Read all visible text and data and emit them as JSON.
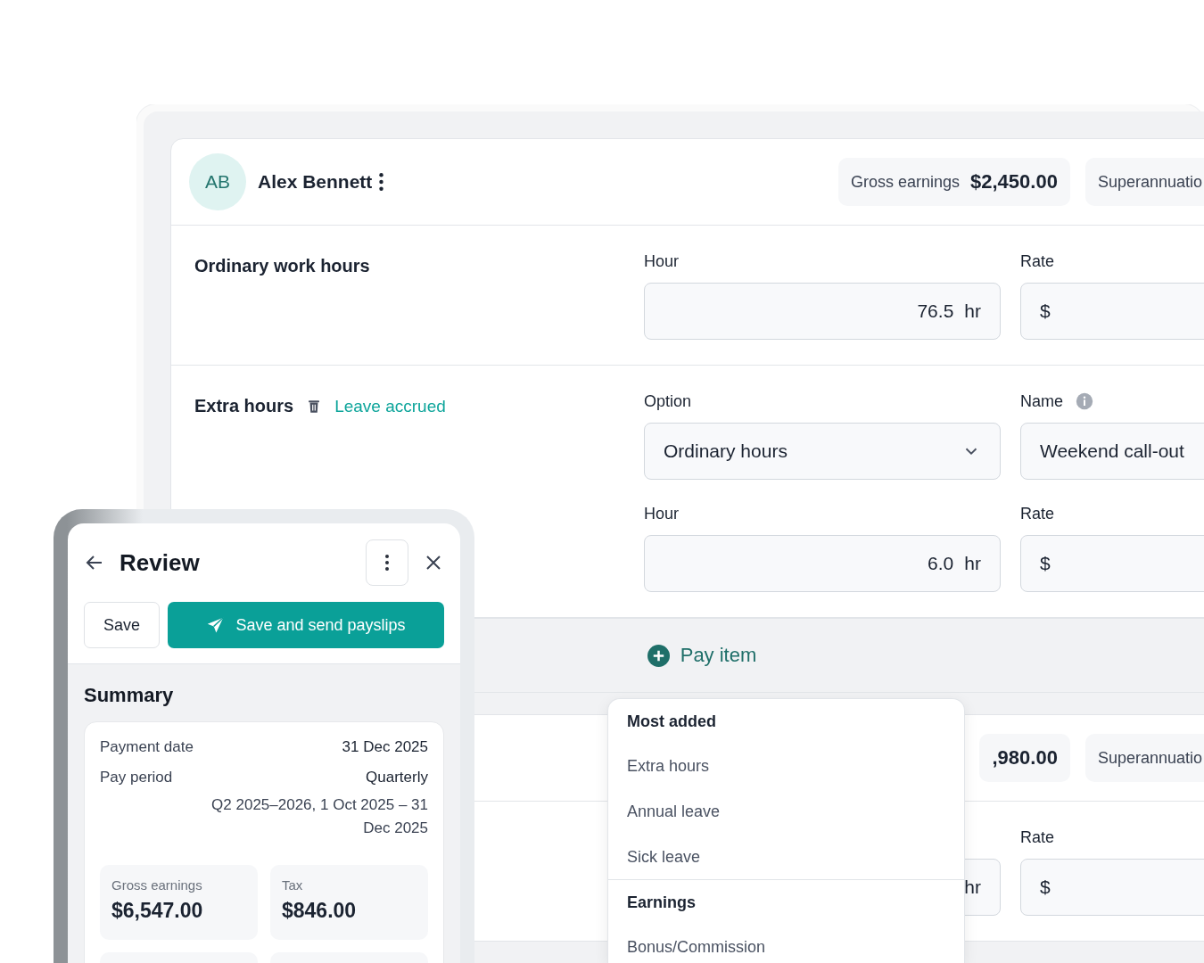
{
  "cards": [
    {
      "initials": "AB",
      "name": "Alex Bennett",
      "chips": [
        {
          "label": "Gross earnings",
          "value": "$2,450.00"
        },
        {
          "label": "Superannuatio"
        }
      ],
      "sections": [
        {
          "title": "Ordinary work hours",
          "deletable": false,
          "fields": [
            {
              "kind": "number",
              "label": "Hour",
              "value": "76.5",
              "unit": "hr"
            },
            {
              "kind": "currency",
              "label": "Rate",
              "prefix": "$"
            }
          ]
        },
        {
          "title": "Extra hours",
          "deletable": true,
          "link": "Leave accrued",
          "fields": [
            {
              "kind": "select",
              "label": "Option",
              "value": "Ordinary hours"
            },
            {
              "kind": "text",
              "label": "Name",
              "info": true,
              "value": "Weekend call-out"
            },
            {
              "kind": "number",
              "label": "Hour",
              "value": "6.0",
              "unit": "hr"
            },
            {
              "kind": "currency",
              "label": "Rate",
              "prefix": "$"
            }
          ]
        }
      ],
      "add_label": "Pay item"
    },
    {
      "chips": [
        {
          "value": ",980.00"
        },
        {
          "label": "Superannuatio"
        }
      ],
      "sections": [
        {
          "deletable": false,
          "fields": [
            {
              "kind": "number",
              "unit": "hr"
            },
            {
              "kind": "currency",
              "label": "Rate",
              "prefix": "$"
            }
          ]
        }
      ]
    }
  ],
  "review": {
    "title": "Review",
    "buttons": [
      {
        "kind": "secondary",
        "label": "Save"
      },
      {
        "kind": "primary",
        "label": "Save and send payslips"
      }
    ],
    "summary": {
      "title": "Summary",
      "rows": [
        {
          "label": "Payment date",
          "value": "31 Dec 2025"
        },
        {
          "label": "Pay period",
          "value": "Quarterly",
          "detail": "Q2 2025–2026, 1 Oct 2025 – 31 Dec 2025"
        }
      ],
      "tiles": [
        {
          "label": "Gross earnings",
          "value": "$6,547.00"
        },
        {
          "label": "Tax",
          "value": "$846.00"
        }
      ]
    }
  },
  "menu": {
    "groups": [
      {
        "title": "Most added",
        "items": [
          "Extra hours",
          "Annual leave",
          "Sick leave"
        ]
      },
      {
        "title": "Earnings",
        "items": [
          "Bonus/Commission"
        ]
      }
    ]
  }
}
